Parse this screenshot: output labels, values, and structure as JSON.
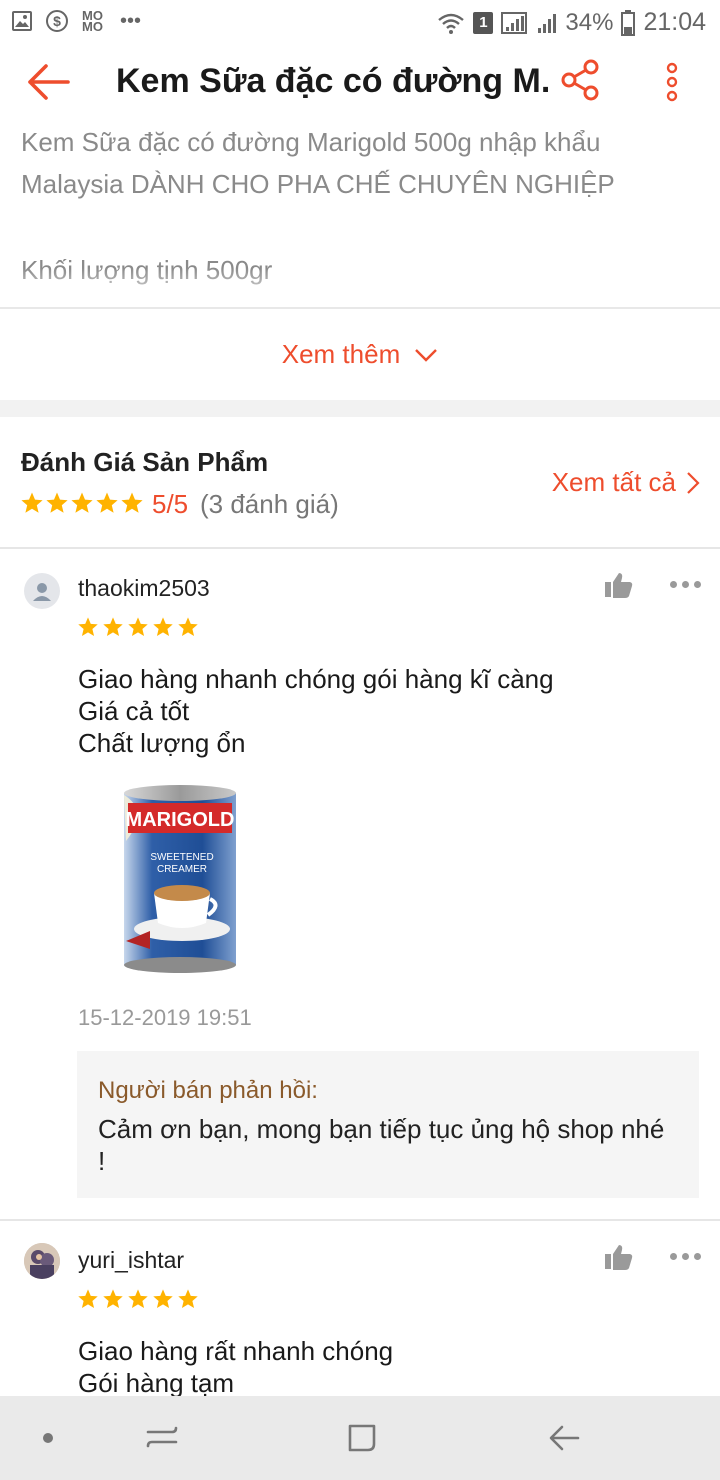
{
  "status_bar": {
    "battery": "34%",
    "time": "21:04",
    "sim_badge": "1",
    "icons": [
      "gallery-icon",
      "s-icon",
      "momo-icon",
      "more-dots-icon",
      "wifi-icon",
      "signal-icon",
      "battery-icon"
    ],
    "momo_label": "MO MO"
  },
  "header": {
    "title": "Kem Sữa đặc có đường M...",
    "accent": "#ee4d2d"
  },
  "description": {
    "line1": "Kem Sữa đặc có đường Marigold 500g nhập khẩu",
    "line2": "Malaysia DÀNH CHO PHA CHẾ CHUYÊN NGHIỆP",
    "line3": "Khối lượng tịnh 500gr",
    "see_more": "Xem thêm"
  },
  "ratings": {
    "heading": "Đánh Giá Sản Phẩm",
    "score": "5/5",
    "count": "(3 đánh giá)",
    "see_all": "Xem tất cả",
    "star_color": "#ffb300"
  },
  "reviews": [
    {
      "user": "thaokim2503",
      "stars": 5,
      "lines": [
        "Giao hàng nhanh chóng gói hàng kĩ càng",
        "Giá cả tốt",
        "Chất lượng ổn"
      ],
      "date": "15-12-2019 19:51",
      "photo_brand": "MARIGOLD",
      "photo_caption1": "SWEETENED",
      "photo_caption2": "CREAMER",
      "seller_label": "Người bán phản hồi:",
      "seller_reply": "Cảm ơn bạn, mong bạn tiếp tục ủng hộ shop nhé !"
    },
    {
      "user": "yuri_ishtar",
      "stars": 5,
      "lines": [
        "Giao hàng rất nhanh chóng",
        "Gói hàng tạm"
      ]
    }
  ]
}
